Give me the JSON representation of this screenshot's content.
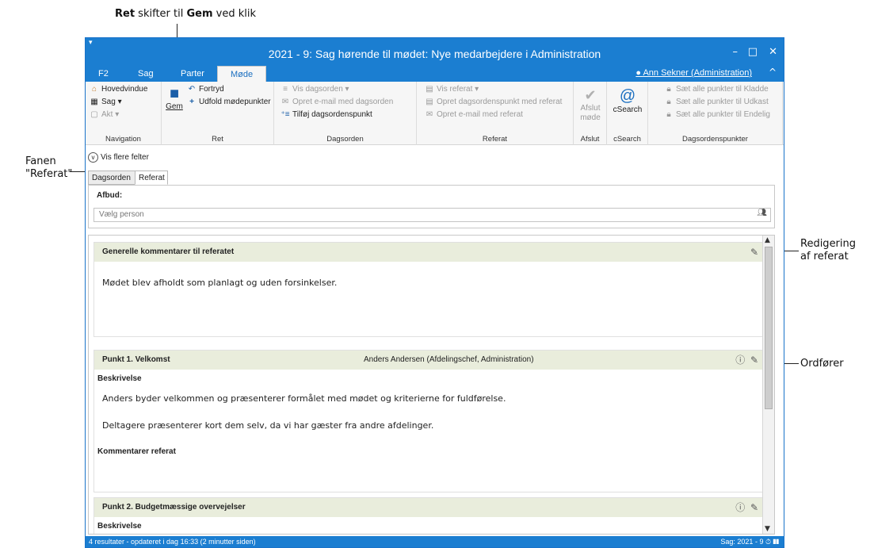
{
  "callouts": {
    "top_bold1": "Ret",
    "top_mid": " skifter til ",
    "top_bold2": "Gem",
    "top_end": " ved klik",
    "fanen_line1": "Fanen",
    "fanen_line2": "\"Referat\"",
    "redigering_line1": "Redigering",
    "redigering_line2": "af referat",
    "ordforer": "Ordfører"
  },
  "window": {
    "title": "2021 - 9: Sag hørende til mødet: Nye medarbejdere i Administration",
    "qat_label": "▾",
    "user": "Ann Sekner (Administration)",
    "tabs": [
      "F2",
      "Sag",
      "Parter",
      "Møde"
    ]
  },
  "ribbon": {
    "navigation": {
      "label": "Navigation",
      "items": [
        "Hovedvindue",
        "Sag ▾",
        "Akt ▾"
      ]
    },
    "ret": {
      "label": "Ret",
      "gem": "Gem",
      "fortryd": "Fortryd",
      "udfold": "Udfold mødepunkter"
    },
    "dagsorden": {
      "label": "Dagsorden",
      "items": [
        "Vis dagsorden ▾",
        "Opret e-mail med dagsorden",
        "Tilføj dagsordenspunkt"
      ]
    },
    "referat": {
      "label": "Referat",
      "items": [
        "Vis referat ▾",
        "Opret dagsordenspunkt med referat",
        "Opret e-mail med referat"
      ]
    },
    "afslut": {
      "label": "Afslut",
      "button_line1": "Afslut",
      "button_line2": "møde"
    },
    "csearch": {
      "label": "cSearch",
      "button": "cSearch"
    },
    "dagsordenspunkter": {
      "label": "Dagsordenspunkter",
      "items": [
        "Sæt alle punkter til Kladde",
        "Sæt alle punkter til Udkast",
        "Sæt alle punkter til Endelig"
      ]
    }
  },
  "vis_flere": "Vis flere felter",
  "content_tabs": [
    "Dagsorden",
    "Referat"
  ],
  "afbud": {
    "label": "Afbud:",
    "placeholder": "Vælg person"
  },
  "sections": {
    "general": {
      "title": "Generelle kommentarer til referatet",
      "text": "Mødet blev afholdt som planlagt og uden forsinkelser."
    },
    "punkt1": {
      "title": "Punkt 1.  Velkomst",
      "speaker": "Anders Andersen (Afdelingschef, Administration)",
      "beskrivelse_label": "Beskrivelse",
      "text1": "Anders byder velkommen og præsenterer formålet med mødet og kriterierne for fuldførelse.",
      "text2": "Deltagere præsenterer kort dem selv, da vi har gæster fra andre afdelinger.",
      "kommentarer_label": "Kommentarer referat"
    },
    "punkt2": {
      "title": "Punkt 2.  Budgetmæssige overvejelser",
      "beskrivelse_label": "Beskrivelse"
    }
  },
  "statusbar": {
    "left": "4 resultater - opdateret i dag 16:33 (2 minutter siden)",
    "right": "Sag: 2021 - 9"
  }
}
